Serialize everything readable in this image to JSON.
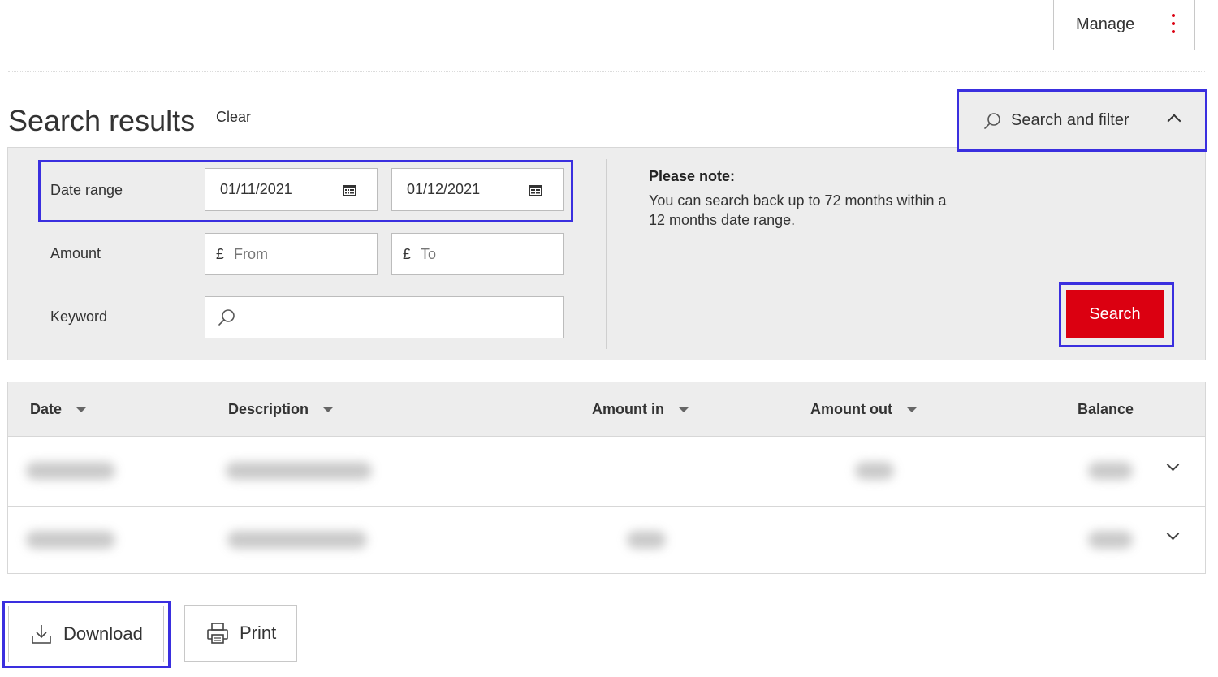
{
  "header": {
    "manage_label": "Manage"
  },
  "search": {
    "title": "Search results",
    "clear_label": "Clear",
    "toggle_label": "Search and filter"
  },
  "filters": {
    "date_range_label": "Date range",
    "date_from": "01/11/2021",
    "date_to": "01/12/2021",
    "amount_label": "Amount",
    "currency_symbol": "£",
    "amount_from_placeholder": "From",
    "amount_to_placeholder": "To",
    "keyword_label": "Keyword",
    "keyword_value": "",
    "note_title": "Please note:",
    "note_text": "You can search back up to 72 months within a 12 months date range.",
    "search_button": "Search"
  },
  "table": {
    "columns": [
      "Date",
      "Description",
      "Amount in",
      "Amount out",
      "Balance"
    ],
    "rows_count_visible": 2
  },
  "actions": {
    "download_label": "Download",
    "print_label": "Print"
  },
  "colors": {
    "brand_red": "#db0011",
    "highlight_outline": "#3a2fdf",
    "panel_bg": "#ededed"
  },
  "icons": [
    "kebab-menu-icon",
    "search-icon",
    "chevron-up-icon",
    "calendar-icon",
    "sort-down-icon",
    "chevron-down-icon",
    "download-icon",
    "print-icon"
  ]
}
